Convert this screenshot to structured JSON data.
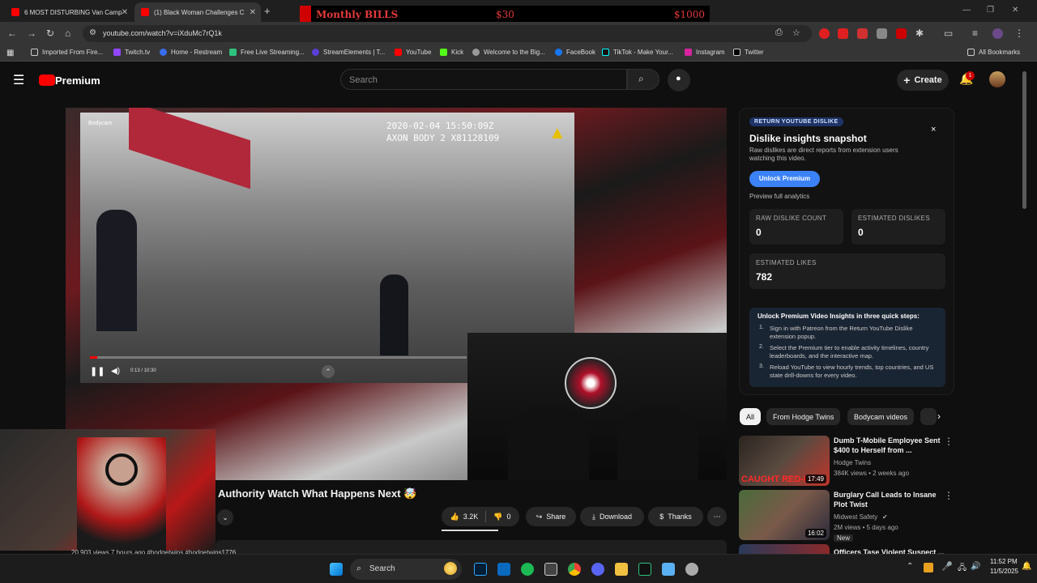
{
  "browser": {
    "tabs": [
      {
        "title": "6 MOST DISTURBING Van Camp"
      },
      {
        "title": "(1) Black Woman Challenges C"
      }
    ],
    "new_tab_label": "+",
    "url": "youtube.com/watch?v=iXduMc7rQ1k",
    "bookmarks": [
      "Imported From Fire...",
      "Twitch.tv",
      "Home - Restream",
      "Free Live Streaming...",
      "StreamElements | T...",
      "YouTube",
      "Kick",
      "Welcome to the Big...",
      "FaceBook",
      "TikTok - Make Your...",
      "Instagram",
      "Twitter"
    ],
    "all_bookmarks": "All Bookmarks"
  },
  "overlay": {
    "title": "Monthly BILLS",
    "left": "$30",
    "right": "$1000"
  },
  "youtube": {
    "brand": "Premium",
    "search_placeholder": "Search",
    "create_label": "Create",
    "notif_count": "1"
  },
  "video": {
    "title": "Authority Watch What Happens Next 🤯",
    "bodycam_label": "Bodycam",
    "stamp_line1": "2020-02-04 15:50:09Z",
    "stamp_line2": "AXON BODY 2 X81128109",
    "time": "0:13 / 10:30",
    "progress_fraction": 0.02,
    "stats_line": "20,903 views  7 hours ago  #hodgetwins #hodgetwins1776"
  },
  "actions": {
    "likes": "3.2K",
    "dislikes": "0",
    "share": "Share",
    "download": "Download",
    "thanks": "Thanks",
    "more": "⋯"
  },
  "panel": {
    "badge": "RETURN YOUTUBE DISLIKE",
    "title": "Dislike insights snapshot",
    "desc": "Raw dislikes are direct reports from extension users watching this video.",
    "unlock_btn": "Unlock Premium",
    "preview": "Preview full analytics",
    "raw_label": "RAW DISLIKE COUNT",
    "raw_value": "0",
    "est_dislike_label": "ESTIMATED DISLIKES",
    "est_dislike_value": "0",
    "est_like_label": "ESTIMATED LIKES",
    "est_like_value": "782",
    "steps_title": "Unlock Premium Video Insights in three quick steps:",
    "steps": [
      "Sign in with Patreon from the Return YouTube Dislike extension popup.",
      "Select the Premium tier to enable activity timelines, country leaderboards, and the interactive map.",
      "Reload YouTube to view hourly trends, top countries, and US state drill-downs for every video."
    ],
    "close": "×"
  },
  "chips": [
    "All",
    "From Hodge Twins",
    "Bodycam videos"
  ],
  "recommendations": [
    {
      "title": "Dumb T-Mobile Employee Sent $400 to Herself from ...",
      "channel": "Hodge Twins",
      "meta": "384K views • 2 weeks ago",
      "duration": "17:49",
      "thumb_text": "CAUGHT RED-HA"
    },
    {
      "title": "Burglary Call Leads to Insane Plot Twist",
      "channel": "Midwest Safety",
      "meta": "2M views • 5 days ago",
      "duration": "16:02",
      "badge": "New"
    },
    {
      "title": "Officers Tase Violent Suspect ..."
    }
  ],
  "taskbar": {
    "search": "Search",
    "time": "11:52 PM",
    "date": "11/5/2025"
  }
}
